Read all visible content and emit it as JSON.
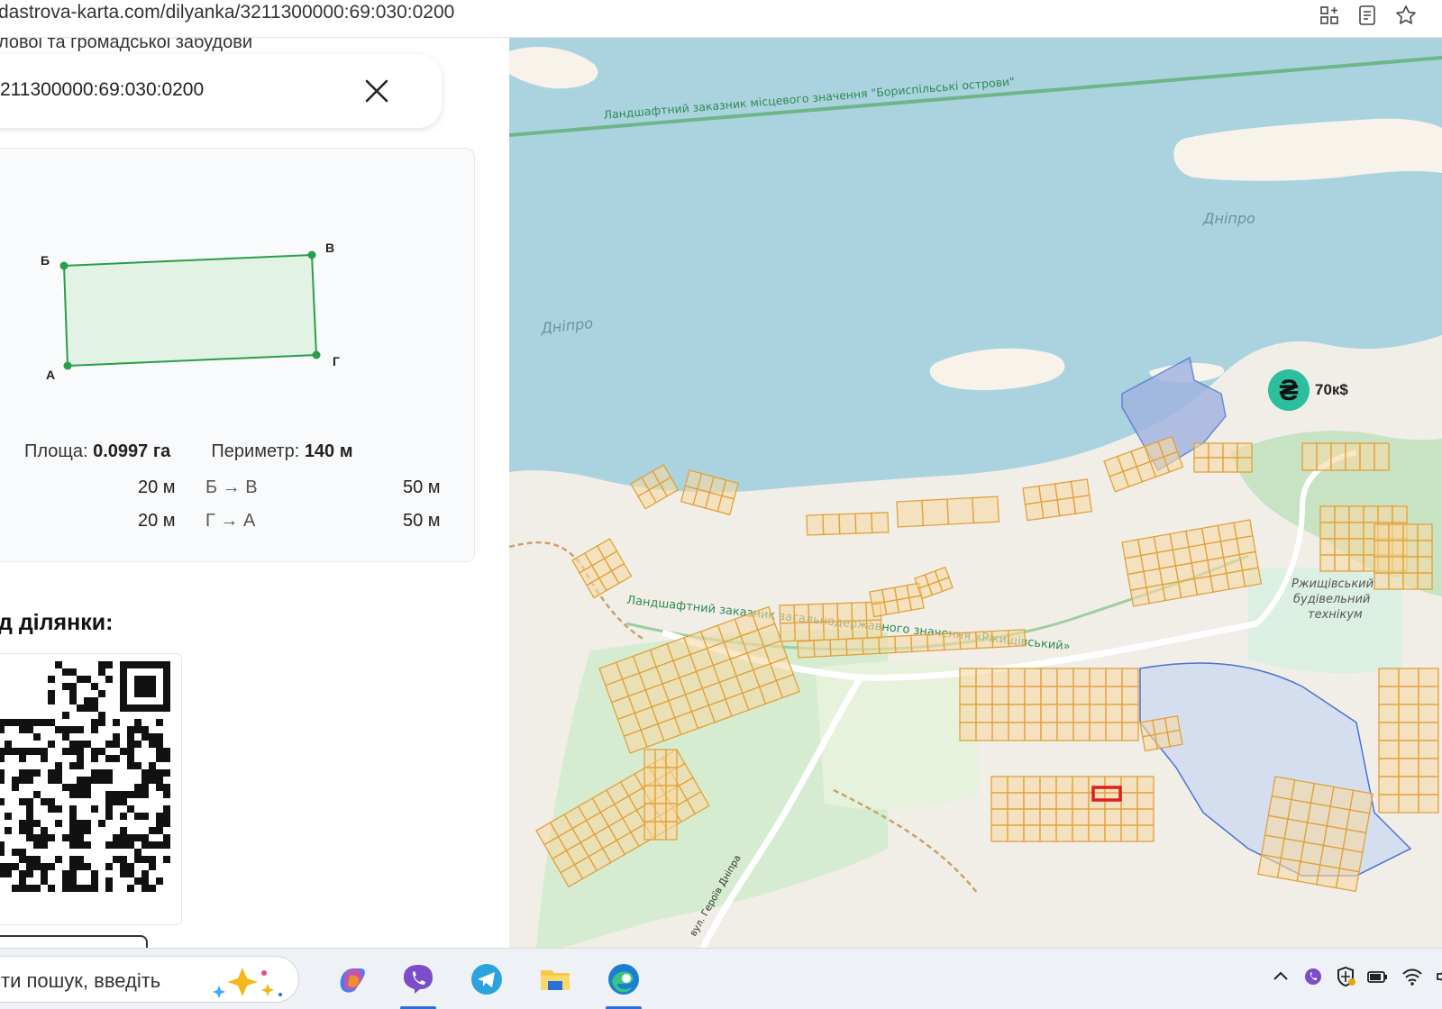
{
  "browser": {
    "url": "dastrova-karta.com/dilyanka/3211300000:69:030:0200"
  },
  "panel": {
    "prev_title": "ловоі та громадськоі забудови",
    "search": {
      "value": "211300000:69:030:0200"
    },
    "parcel": {
      "vertices": [
        "А",
        "Б",
        "В",
        "Г"
      ],
      "area_label": "Площа:",
      "area_value": "0.0997 га",
      "perimeter_label": "Периметр:",
      "perimeter_value": "140 м",
      "edges": [
        {
          "left_length": "20 м",
          "name": "Б → В",
          "right_length": "50 м"
        },
        {
          "left_length": "20 м",
          "name": "Г → А",
          "right_length": "50 м"
        }
      ]
    },
    "qr_title": "д ділянки:"
  },
  "map": {
    "labels": {
      "reserve_top": "Ландшафтний заказник місцевого значення \"Бориспільські острови\"",
      "river_right": "Дніпро",
      "river_left": "Дніпро",
      "reserve_mid": "Ландшафтний заказник загальнодержавного значення «Ржищівський»",
      "college_1": "Ржищівський",
      "college_2": "будівельний",
      "college_3": "технікум",
      "street": "вул. Героїв Дніпра"
    },
    "price_badge": {
      "symbol": "₴",
      "value": "70к$"
    },
    "colors": {
      "water": "#aad3df",
      "land": "#f1eee8",
      "parcel_fill": "#f7d9a4",
      "parcel_stroke": "#e0a23a",
      "reserve_green": "#2f9e5c",
      "highlight": "#e11d1d"
    }
  },
  "taskbar": {
    "search_text": "ти пошук, введіть",
    "apps": [
      "copilot-icon",
      "viber-icon",
      "telegram-icon",
      "file-explorer-icon",
      "edge-icon"
    ]
  }
}
